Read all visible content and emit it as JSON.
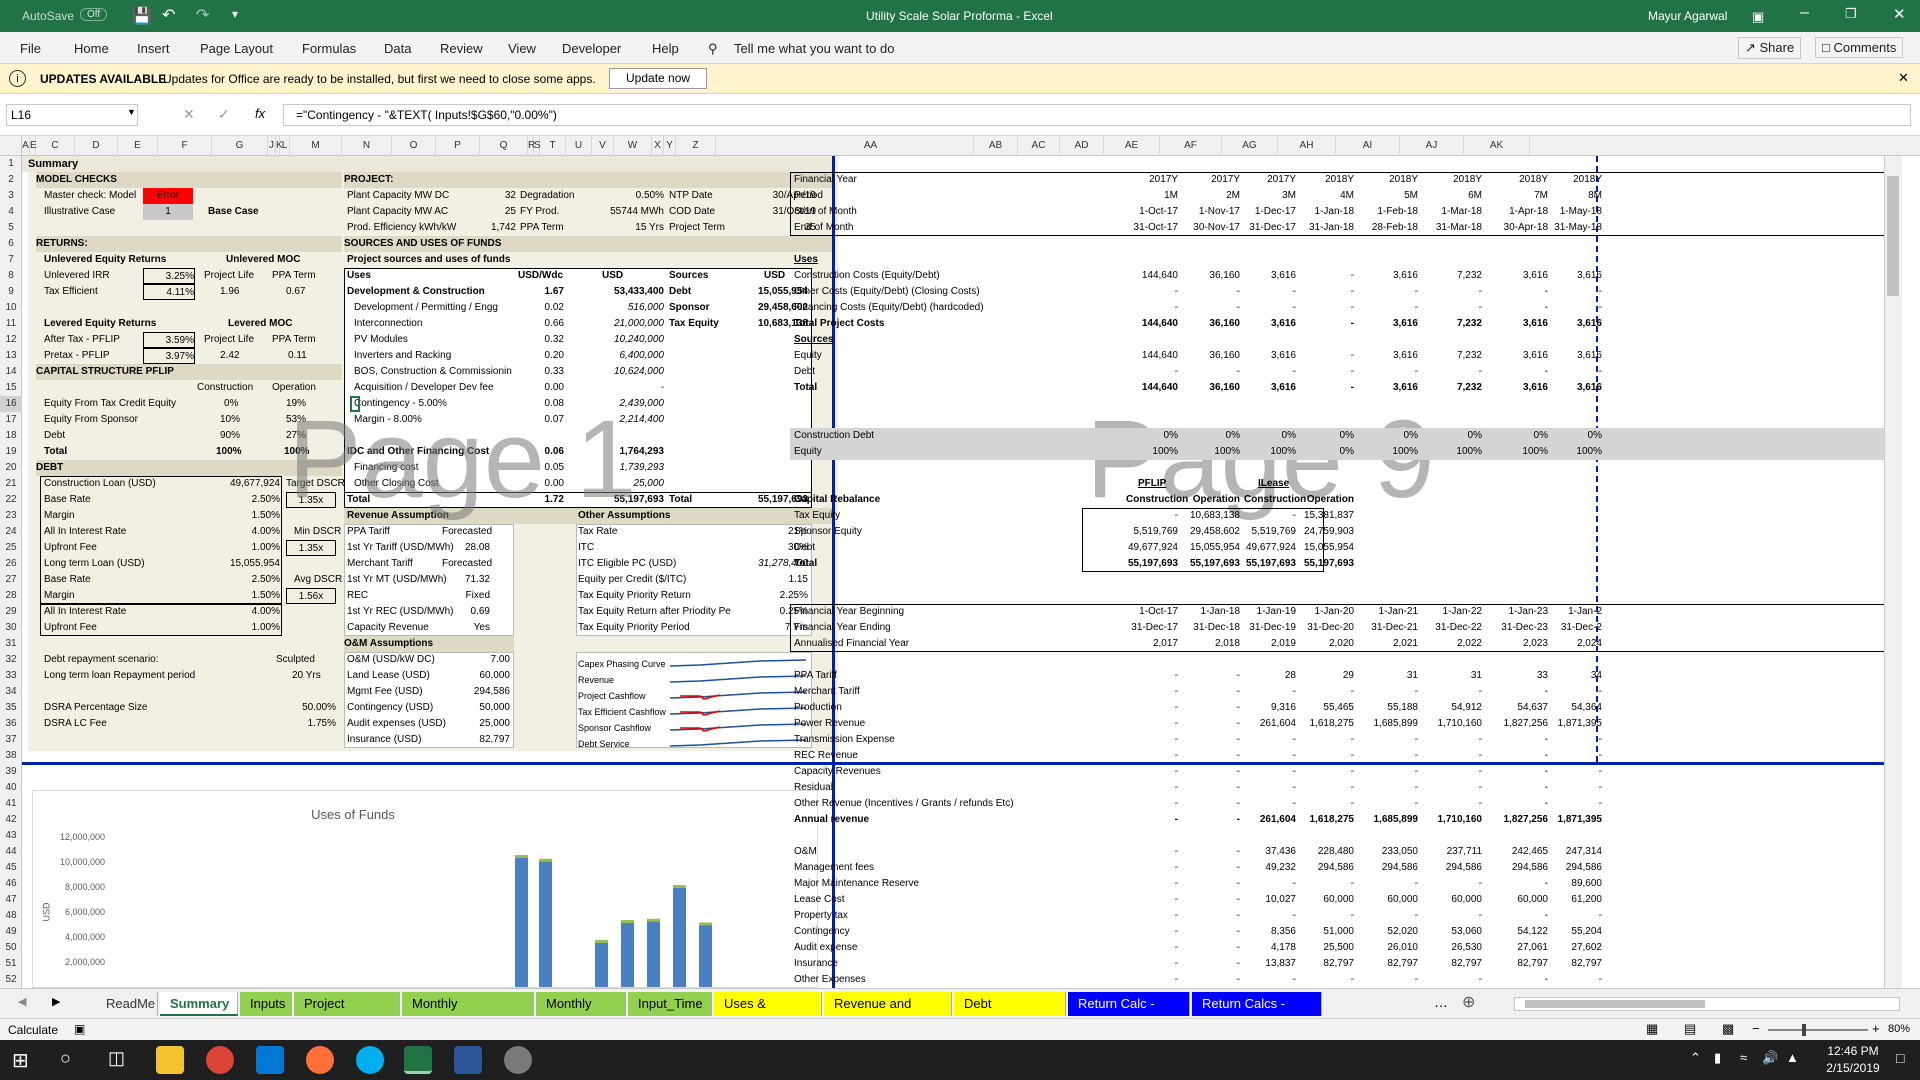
{
  "window": {
    "autosave": "AutoSave",
    "autosave_state": "Off",
    "title": "Utility Scale Solar Proforma  -  Excel",
    "user": "Mayur Agarwal"
  },
  "ribbon": {
    "tabs": [
      "File",
      "Home",
      "Insert",
      "Page Layout",
      "Formulas",
      "Data",
      "Review",
      "View",
      "Developer",
      "Help"
    ],
    "tell_me": "Tell me what you want to do",
    "share": "Share",
    "comments": "Comments"
  },
  "update": {
    "title": "UPDATES AVAILABLE",
    "message": "Updates for Office are ready to be installed, but first we need to close some apps.",
    "button": "Update now"
  },
  "formula": {
    "name_box": "L16",
    "fx": "fx",
    "content": "=\"Contingency - \"&TEXT( Inputs!$G$60,\"0.00%\")"
  },
  "columns": {
    "left": [
      "A",
      "E",
      "C",
      "D",
      "E",
      "F",
      "G",
      "J",
      "K",
      "L",
      "M",
      "N",
      "O",
      "P",
      "Q",
      "R",
      "S",
      "T",
      "U",
      "V",
      "W",
      "X",
      "Y",
      "Z"
    ],
    "right": [
      "AA",
      "AB",
      "AC",
      "AD",
      "AE",
      "AF",
      "AG",
      "AH",
      "AI",
      "AJ",
      "AK"
    ]
  },
  "rows": [
    "1",
    "2",
    "3",
    "4",
    "5",
    "6",
    "7",
    "8",
    "9",
    "10",
    "11",
    "12",
    "13",
    "14",
    "15",
    "16",
    "17",
    "18",
    "19",
    "20",
    "21",
    "22",
    "23",
    "24",
    "25",
    "26",
    "27",
    "28",
    "29",
    "30",
    "31",
    "32",
    "33",
    "34",
    "35",
    "36",
    "37",
    "38",
    "39",
    "40",
    "41",
    "42",
    "43",
    "44",
    "45",
    "46",
    "47",
    "48",
    "49",
    "50",
    "51",
    "52"
  ],
  "summary": {
    "title": "Summary",
    "model_checks": "MODEL CHECKS",
    "master_check": "Master check: Model",
    "master_value": "Error",
    "illustrative": "Illustrative Case",
    "illustrative_value": "1",
    "base_case": "Base Case",
    "returns": "RETURNS:",
    "unlev_head": "Unlevered Equity Returns",
    "unlev_moc": "Unlevered MOC",
    "unlev_irr": "Unlevered IRR",
    "unlev_irr_v": "3.25%",
    "proj_life": "Project Life",
    "ppa_term": "PPA Term",
    "tax_eff": "Tax Efficient",
    "tax_eff_v": "4.11%",
    "tax_eff_pl": "1.96",
    "tax_eff_pt": "0.67",
    "lev_head": "Levered Equity Returns",
    "lev_moc": "Levered MOC",
    "after_tax": "After Tax - PFLIP",
    "after_tax_v": "3.59%",
    "pretax": "Pretax - PFLIP",
    "pretax_v": "3.97%",
    "pretax_pl": "2.42",
    "pretax_pt": "0.11",
    "cap_struct": "CAPITAL STRUCTURE PFLIP",
    "construction": "Construction",
    "operation": "Operation",
    "eq_tax": "Equity From Tax Credit Equity",
    "eq_tax_c": "0%",
    "eq_tax_o": "19%",
    "eq_sp": "Equity From Sponsor",
    "eq_sp_c": "10%",
    "eq_sp_o": "53%",
    "debt": "Debt",
    "debt_c": "90%",
    "debt_o": "27%",
    "total": "Total",
    "total_c": "100%",
    "total_o": "100%",
    "debt_head": "DEBT",
    "cl": "Construction Loan (USD)",
    "cl_v": "49,677,924",
    "target_dscr": "Target DSCR",
    "base_rate": "Base Rate",
    "br_v": "2.50%",
    "tdscr_v": "1.35x",
    "margin": "Margin",
    "m_v": "1.50%",
    "all_in": "All In Interest Rate",
    "ai_v": "4.00%",
    "min_dscr": "Min DSCR",
    "upfront": "Upfront Fee",
    "uf_v": "1.00%",
    "mdscr_v": "1.35x",
    "ltl": "Long term Loan (USD)",
    "ltl_v": "15,055,954",
    "br2_v": "2.50%",
    "avg_dscr": "Avg DSCR",
    "m2_v": "1.50%",
    "adscr_v": "1.56x",
    "ai2_v": "4.00%",
    "uf2_v": "1.00%",
    "debt_rep": "Debt repayment scenario:",
    "sculpted": "Sculpted",
    "ltl_period": "Long term loan Repayment period",
    "yrs": "20 Yrs",
    "dsra_pct": "DSRA Percentage Size",
    "dsra_pct_v": "50.00%",
    "dsra_lc": "DSRA LC Fee",
    "dsra_lc_v": "1.75%",
    "project": "PROJECT:",
    "pc_dc": "Plant Capacity MW DC",
    "pc_dc_v": "32",
    "degr": "Degradation",
    "degr_v": "0.50%",
    "ntp": "NTP Date",
    "ntp_v": "30/Apr/19",
    "pc_ac": "Plant Capacity MW AC",
    "pc_ac_v": "25",
    "fyprod": "FY Prod.",
    "fyprod_v": "55744 MWh",
    "cod": "COD Date",
    "cod_v": "31/Oct/19",
    "prod_eff": "Prod. Efficiency kWh/kW",
    "prod_eff_v": "1,742",
    "ppa_t": "PPA Term",
    "ppa_t_v": "15 Yrs",
    "pt": "Project Term",
    "pt_v": "35",
    "su": "SOURCES AND USES OF FUNDS",
    "psu": "Project sources and uses of funds",
    "uses": "Uses",
    "usdwdc": "USD/Wdc",
    "usd": "USD",
    "sources": "Sources",
    "usd2": "USD",
    "uses_rows": [
      {
        "l": "Development & Construction",
        "w": "1.67",
        "u": "53,433,400",
        "s": "Debt",
        "sv": "15,055,954",
        "bold": true
      },
      {
        "l": "Development / Permitting / Engg",
        "w": "0.02",
        "u": "516,000",
        "s": "Sponsor",
        "sv": "29,458,602"
      },
      {
        "l": "Interconnection",
        "w": "0.66",
        "u": "21,000,000",
        "s": "Tax Equity",
        "sv": "10,683,138"
      },
      {
        "l": "PV Modules",
        "w": "0.32",
        "u": "10,240,000",
        "s": "",
        "sv": ""
      },
      {
        "l": "Inverters and Racking",
        "w": "0.20",
        "u": "6,400,000",
        "s": "",
        "sv": ""
      },
      {
        "l": "BOS, Construction & Commissionin",
        "w": "0.33",
        "u": "10,624,000",
        "s": "",
        "sv": ""
      },
      {
        "l": "Acquisition / Developer Dev fee",
        "w": "0.00",
        "u": "-",
        "s": "",
        "sv": ""
      },
      {
        "l": "Contingency - 5.00%",
        "w": "0.08",
        "u": "2,439,000",
        "s": "",
        "sv": ""
      },
      {
        "l": "Margin - 8.00%",
        "w": "0.07",
        "u": "2,214,400",
        "s": "",
        "sv": ""
      },
      {
        "l": "",
        "w": "",
        "u": "",
        "s": "",
        "sv": ""
      },
      {
        "l": "IDC and Other Financing Cost",
        "w": "0.06",
        "u": "1,764,293",
        "s": "",
        "sv": "",
        "bold": true
      },
      {
        "l": "Financing cost",
        "w": "0.05",
        "u": "1,739,293",
        "s": "",
        "sv": ""
      },
      {
        "l": "Other Closing Cost",
        "w": "0.00",
        "u": "25,000",
        "s": "",
        "sv": ""
      },
      {
        "l": "Total",
        "w": "1.72",
        "u": "55,197,693",
        "s": "Total",
        "sv": "55,197,693",
        "bold": true
      }
    ],
    "rev_head": "Revenue Assumption",
    "other_head": "Other Assumptions",
    "rev_rows": [
      [
        "PPA Tariff",
        "Forecasted"
      ],
      [
        "1st Yr Tariff (USD/MWh)",
        "28.08"
      ],
      [
        "Merchant Tariff",
        "Forecasted"
      ],
      [
        "1st Yr MT (USD/MWh)",
        "71.32"
      ],
      [
        "REC",
        "Fixed"
      ],
      [
        "1st Yr REC (USD/MWh)",
        "0.69"
      ],
      [
        "Capacity Revenue",
        "Yes"
      ]
    ],
    "oth_rows": [
      [
        "Tax Rate",
        "21%"
      ],
      [
        "ITC",
        "30%"
      ],
      [
        "ITC Eligible PC (USD)",
        "31,278,400"
      ],
      [
        "Equity per Credit ($/ITC)",
        "1.15"
      ],
      [
        "Tax Equity Priority Return",
        "2.25%"
      ],
      [
        "Tax Equity Return after Priodity Pe",
        "0.25%"
      ],
      [
        "Tax Equity Priority Period",
        "7 Yrs"
      ]
    ],
    "om_head": "O&M Assumptions",
    "om_rows": [
      [
        "O&M (USD/kW DC)",
        "7.00"
      ],
      [
        "Land Lease (USD)",
        "60,000"
      ],
      [
        "Mgmt Fee (USD)",
        "294,586"
      ],
      [
        "Contingency (USD)",
        "50,000"
      ],
      [
        "Audit expenses (USD)",
        "25,000"
      ],
      [
        "Insurance (USD)",
        "82,797"
      ]
    ],
    "spark_labels": [
      "Capex Phasing Curve",
      "Revenue",
      "Project Cashflow",
      "Tax Efficient Cashflow",
      "Sponsor Cashflow",
      "Debt Service"
    ],
    "page1": "Page 1",
    "page9": "Page 9"
  },
  "chart_data": {
    "type": "bar",
    "title": "Uses of Funds",
    "ylabel": "USD",
    "yticks": [
      "12,000,000",
      "10,000,000",
      "8,000,000",
      "6,000,000",
      "4,000,000",
      "2,000,000"
    ],
    "ylim": [
      0,
      12000000
    ],
    "values": [
      10400000,
      10100000,
      3600000,
      5200000,
      5300000,
      8000000,
      5000000
    ]
  },
  "right": {
    "headers": [
      {
        "l": "Financial Year",
        "v": [
          "2017Y",
          "2017Y",
          "2017Y",
          "2018Y",
          "2018Y",
          "2018Y",
          "2018Y",
          "2018Y"
        ]
      },
      {
        "l": "Period",
        "v": [
          "1M",
          "2M",
          "3M",
          "4M",
          "5M",
          "6M",
          "7M",
          "8M"
        ]
      },
      {
        "l": "Start of Month",
        "v": [
          "1-Oct-17",
          "1-Nov-17",
          "1-Dec-17",
          "1-Jan-18",
          "1-Feb-18",
          "1-Mar-18",
          "1-Apr-18",
          "1-May-18"
        ]
      },
      {
        "l": "End of Month",
        "v": [
          "31-Oct-17",
          "30-Nov-17",
          "31-Dec-17",
          "31-Jan-18",
          "28-Feb-18",
          "31-Mar-18",
          "30-Apr-18",
          "31-May-18"
        ]
      }
    ],
    "uses_title": "Uses",
    "uses": [
      {
        "l": "Construction Costs (Equity/Debt)",
        "v": [
          "144,640",
          "36,160",
          "3,616",
          "-",
          "3,616",
          "7,232",
          "3,616",
          "3,616"
        ]
      },
      {
        "l": "Other Costs (Equity/Debt) (Closing Costs)",
        "v": [
          "-",
          "-",
          "-",
          "-",
          "-",
          "-",
          "-",
          "-"
        ]
      },
      {
        "l": "Financing Costs (Equity/Debt) (hardcoded)",
        "v": [
          "-",
          "-",
          "-",
          "-",
          "-",
          "-",
          "-",
          "-"
        ]
      },
      {
        "l": "Total Project Costs",
        "v": [
          "144,640",
          "36,160",
          "3,616",
          "-",
          "3,616",
          "7,232",
          "3,616",
          "3,616"
        ],
        "bold": true
      }
    ],
    "sources_title": "Sources",
    "sources": [
      {
        "l": "Equity",
        "v": [
          "144,640",
          "36,160",
          "3,616",
          "-",
          "3,616",
          "7,232",
          "3,616",
          "3,616"
        ]
      },
      {
        "l": "Debt",
        "v": [
          "-",
          "-",
          "-",
          "-",
          "-",
          "-",
          "-",
          "-"
        ]
      },
      {
        "l": "Total",
        "v": [
          "144,640",
          "36,160",
          "3,616",
          "-",
          "3,616",
          "7,232",
          "3,616",
          "3,616"
        ],
        "bold": true
      }
    ],
    "pct": [
      {
        "l": "Construction Debt",
        "v": [
          "0%",
          "0%",
          "0%",
          "0%",
          "0%",
          "0%",
          "0%",
          "0%"
        ]
      },
      {
        "l": "Equity",
        "v": [
          "100%",
          "100%",
          "100%",
          "0%",
          "100%",
          "100%",
          "100%",
          "100%"
        ]
      }
    ],
    "rebal": {
      "pflip": "PFLIP",
      "ilease": "ILease",
      "cap_reb": "Capital Rebalance",
      "construction": "Construction",
      "operation": "Operation",
      "rows": [
        [
          "Tax Equity",
          "-",
          "10,683,138",
          "-",
          "15,381,837"
        ],
        [
          "Sponsor Equity",
          "5,519,769",
          "29,458,602",
          "5,519,769",
          "24,759,903"
        ],
        [
          "Debt",
          "49,677,924",
          "15,055,954",
          "49,677,924",
          "15,055,954"
        ],
        [
          "Total",
          "55,197,693",
          "55,197,693",
          "55,197,693",
          "55,197,693"
        ]
      ]
    },
    "fy": [
      {
        "l": "Financial Year Beginning",
        "v": [
          "1-Oct-17",
          "1-Jan-18",
          "1-Jan-19",
          "1-Jan-20",
          "1-Jan-21",
          "1-Jan-22",
          "1-Jan-23",
          "1-Jan-2"
        ]
      },
      {
        "l": "Financial Year Ending",
        "v": [
          "31-Dec-17",
          "31-Dec-18",
          "31-Dec-19",
          "31-Dec-20",
          "31-Dec-21",
          "31-Dec-22",
          "31-Dec-23",
          "31-Dec-2"
        ]
      },
      {
        "l": "Annualised Financial Year",
        "v": [
          "2,017",
          "2,018",
          "2,019",
          "2,020",
          "2,021",
          "2,022",
          "2,023",
          "2,024"
        ]
      }
    ],
    "rev": [
      {
        "l": "PPA Tariff",
        "v": [
          "-",
          "-",
          "28",
          "29",
          "31",
          "31",
          "33",
          "34"
        ]
      },
      {
        "l": "Merchant Tariff",
        "v": [
          "-",
          "-",
          "-",
          "-",
          "-",
          "-",
          "-",
          "-"
        ]
      },
      {
        "l": "Production",
        "v": [
          "-",
          "-",
          "9,316",
          "55,465",
          "55,188",
          "54,912",
          "54,637",
          "54,364"
        ]
      },
      {
        "l": "Power Revenue",
        "v": [
          "-",
          "-",
          "261,604",
          "1,618,275",
          "1,685,899",
          "1,710,160",
          "1,827,256",
          "1,871,395"
        ]
      },
      {
        "l": "Transmission Expense",
        "v": [
          "-",
          "-",
          "-",
          "-",
          "-",
          "-",
          "-",
          "-"
        ]
      },
      {
        "l": "REC Revenue",
        "v": [
          "-",
          "-",
          "-",
          "-",
          "-",
          "-",
          "-",
          "-"
        ]
      },
      {
        "l": "Capacity Revenues",
        "v": [
          "-",
          "-",
          "-",
          "-",
          "-",
          "-",
          "-",
          "-"
        ]
      },
      {
        "l": "Residual",
        "v": [
          "-",
          "-",
          "-",
          "-",
          "-",
          "-",
          "-",
          "-"
        ]
      },
      {
        "l": "Other Revenue (Incentives / Grants / refunds Etc)",
        "v": [
          "-",
          "-",
          "-",
          "-",
          "-",
          "-",
          "-",
          "-"
        ]
      },
      {
        "l": "Annual revenue",
        "v": [
          "-",
          "-",
          "261,604",
          "1,618,275",
          "1,685,899",
          "1,710,160",
          "1,827,256",
          "1,871,395"
        ],
        "bold": true
      }
    ],
    "opex": [
      {
        "l": "O&M",
        "v": [
          "-",
          "-",
          "37,436",
          "228,480",
          "233,050",
          "237,711",
          "242,465",
          "247,314"
        ]
      },
      {
        "l": "Management fees",
        "v": [
          "-",
          "-",
          "49,232",
          "294,586",
          "294,586",
          "294,586",
          "294,586",
          "294,586"
        ]
      },
      {
        "l": "Major Maintenance Reserve",
        "v": [
          "-",
          "-",
          "-",
          "-",
          "-",
          "-",
          "-",
          "89,600"
        ]
      },
      {
        "l": "Lease Cost",
        "v": [
          "-",
          "-",
          "10,027",
          "60,000",
          "60,000",
          "60,000",
          "60,000",
          "61,200"
        ]
      },
      {
        "l": "Property tax",
        "v": [
          "-",
          "-",
          "-",
          "-",
          "-",
          "-",
          "-",
          "-"
        ]
      },
      {
        "l": "Contingency",
        "v": [
          "-",
          "-",
          "8,356",
          "51,000",
          "52,020",
          "53,060",
          "54,122",
          "55,204"
        ]
      },
      {
        "l": "Audit expense",
        "v": [
          "-",
          "-",
          "4,178",
          "25,500",
          "26,010",
          "26,530",
          "27,061",
          "27,602"
        ]
      },
      {
        "l": "Insurance",
        "v": [
          "-",
          "-",
          "13,837",
          "82,797",
          "82,797",
          "82,797",
          "82,797",
          "82,797"
        ]
      },
      {
        "l": "Other Expenses",
        "v": [
          "-",
          "-",
          "-",
          "-",
          "-",
          "-",
          "-",
          "-"
        ]
      }
    ]
  },
  "sheets": [
    {
      "name": "ReadMe",
      "color": "#f0f0f0",
      "fg": "#333"
    },
    {
      "name": "Summary",
      "color": "#ffffff",
      "fg": "#217346",
      "active": true
    },
    {
      "name": "Inputs",
      "color": "#92d050",
      "fg": "#000"
    },
    {
      "name": "Project Budget",
      "color": "#92d050",
      "fg": "#000"
    },
    {
      "name": "Monthly Percentage",
      "color": "#92d050",
      "fg": "#000"
    },
    {
      "name": "Monthly Cost",
      "color": "#92d050",
      "fg": "#000"
    },
    {
      "name": "Input_Time",
      "color": "#92d050",
      "fg": "#000"
    },
    {
      "name": "Uses & Sources",
      "color": "#ffff00",
      "fg": "#000"
    },
    {
      "name": "Revenue and Costs",
      "color": "#ffff00",
      "fg": "#000"
    },
    {
      "name": "Debt Repayment",
      "color": "#ffff00",
      "fg": "#000"
    },
    {
      "name": "Return Calc - PFLIP",
      "color": "#0000ff",
      "fg": "#fff"
    },
    {
      "name": "Return Calcs - Inve",
      "color": "#0000ff",
      "fg": "#fff"
    }
  ],
  "status": {
    "mode": "Calculate",
    "zoom": "80%"
  },
  "clock": {
    "time": "12:46 PM",
    "date": "2/15/2019"
  }
}
